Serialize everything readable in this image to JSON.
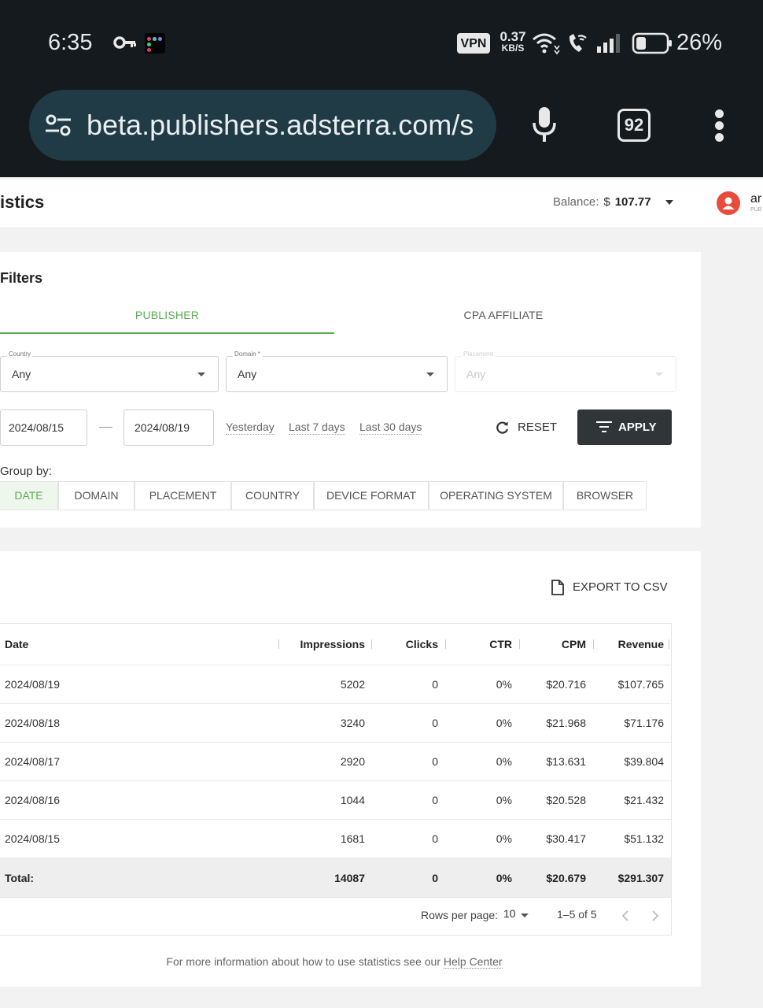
{
  "status_bar": {
    "time": "6:35",
    "vpn": "VPN",
    "net_speed_value": "0.37",
    "net_speed_unit": "KB/S",
    "battery": "26%",
    "icons": [
      "key-icon",
      "app-icon",
      "wifi-icon",
      "wifi-calling-icon",
      "signal-icon",
      "battery-icon"
    ]
  },
  "browser": {
    "url": "beta.publishers.adsterra.com/s",
    "tab_count": "92",
    "icons": [
      "site-settings-icon",
      "mic-icon",
      "tabs-icon",
      "more-icon"
    ]
  },
  "header": {
    "page_title": "istics",
    "balance_label": "Balance:",
    "balance_currency": "$",
    "balance_amount": "107.77",
    "user_name": "ar",
    "user_role": "PUB"
  },
  "filters": {
    "title": "Filters",
    "tabs": [
      {
        "label": "PUBLISHER",
        "active": true
      },
      {
        "label": "CPA AFFILIATE",
        "active": false
      }
    ],
    "country": {
      "label": "Country",
      "value": "Any"
    },
    "domain": {
      "label": "Domain *",
      "value": "Any"
    },
    "placement": {
      "label": "Placement",
      "value": "Any",
      "disabled": true
    },
    "date_from": "2024/08/15",
    "date_to": "2024/08/19",
    "quick_ranges": [
      "Yesterday",
      "Last 7 days",
      "Last 30 days"
    ],
    "reset_label": "RESET",
    "apply_label": "APPLY",
    "group_by_label": "Group by:",
    "group_by_options": [
      "DATE",
      "DOMAIN",
      "PLACEMENT",
      "COUNTRY",
      "DEVICE FORMAT",
      "OPERATING SYSTEM",
      "BROWSER"
    ],
    "group_by_active": "DATE"
  },
  "table": {
    "export_label": "EXPORT TO CSV",
    "columns": [
      "Date",
      "Impressions",
      "Clicks",
      "CTR",
      "CPM",
      "Revenue"
    ],
    "rows": [
      [
        "2024/08/19",
        "5202",
        "0",
        "0%",
        "$20.716",
        "$107.765"
      ],
      [
        "2024/08/18",
        "3240",
        "0",
        "0%",
        "$21.968",
        "$71.176"
      ],
      [
        "2024/08/17",
        "2920",
        "0",
        "0%",
        "$13.631",
        "$39.804"
      ],
      [
        "2024/08/16",
        "1044",
        "0",
        "0%",
        "$20.528",
        "$21.432"
      ],
      [
        "2024/08/15",
        "1681",
        "0",
        "0%",
        "$30.417",
        "$51.132"
      ]
    ],
    "total": [
      "Total:",
      "14087",
      "0",
      "0%",
      "$20.679",
      "$291.307"
    ],
    "rows_per_page_label": "Rows per page:",
    "rows_per_page": "10",
    "range": "1–5 of 5",
    "help_prefix": "For more information about how to use statistics see our ",
    "help_link": "Help Center",
    "colors": {
      "accent": "#5cab55",
      "apply_bg": "#303538",
      "avatar": "#e74c3c"
    }
  }
}
